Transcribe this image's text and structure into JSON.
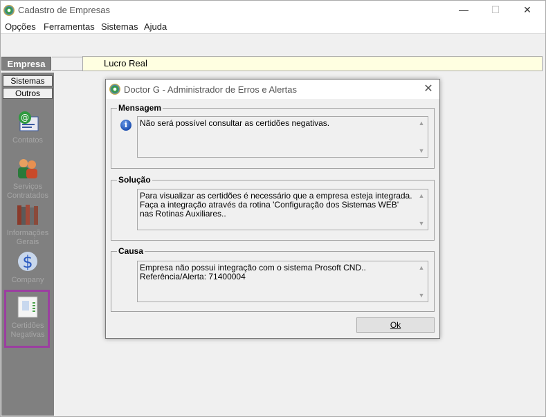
{
  "window": {
    "title": "Cadastro de Empresas",
    "min_glyph": "—",
    "max_glyph": "☐",
    "close_glyph": "✕"
  },
  "menu": [
    "Opções",
    "Ferramentas",
    "Sistemas",
    "Ajuda"
  ],
  "empresa": {
    "tab_label": "Empresa",
    "value": "Lucro Real"
  },
  "sidebar": {
    "buttons": [
      "Sistemas",
      "Outros"
    ],
    "items": [
      {
        "label": "Contatos",
        "icon": "contacts-icon"
      },
      {
        "label": "Serviços Contratados",
        "icon": "services-icon"
      },
      {
        "label": "Informações Gerais",
        "icon": "books-icon"
      },
      {
        "label": "Company",
        "icon": "company-icon"
      },
      {
        "label": "Certidões Negativas",
        "icon": "certificates-icon"
      }
    ]
  },
  "dialog": {
    "title": "Doctor G - Administrador de Erros e Alertas",
    "close_glyph": "✕",
    "mensagem": {
      "label": "Mensagem",
      "text": "Não será possível consultar as certidões negativas."
    },
    "solucao": {
      "label": "Solução",
      "text": "Para visualizar as certidões é necessário que a empresa esteja integrada. Faça a integração através da rotina 'Configuração dos Sistemas WEB' nas Rotinas Auxiliares.."
    },
    "causa": {
      "label": "Causa",
      "line1": "Empresa  não possui integração com o sistema Prosoft CND..",
      "line2": "Referência/Alerta: 71400004"
    },
    "ok_label": "Ok"
  },
  "colors": {
    "highlight": "#9b3fa0",
    "field_bg": "#ffffe1",
    "sidebar_bg": "#808080"
  }
}
